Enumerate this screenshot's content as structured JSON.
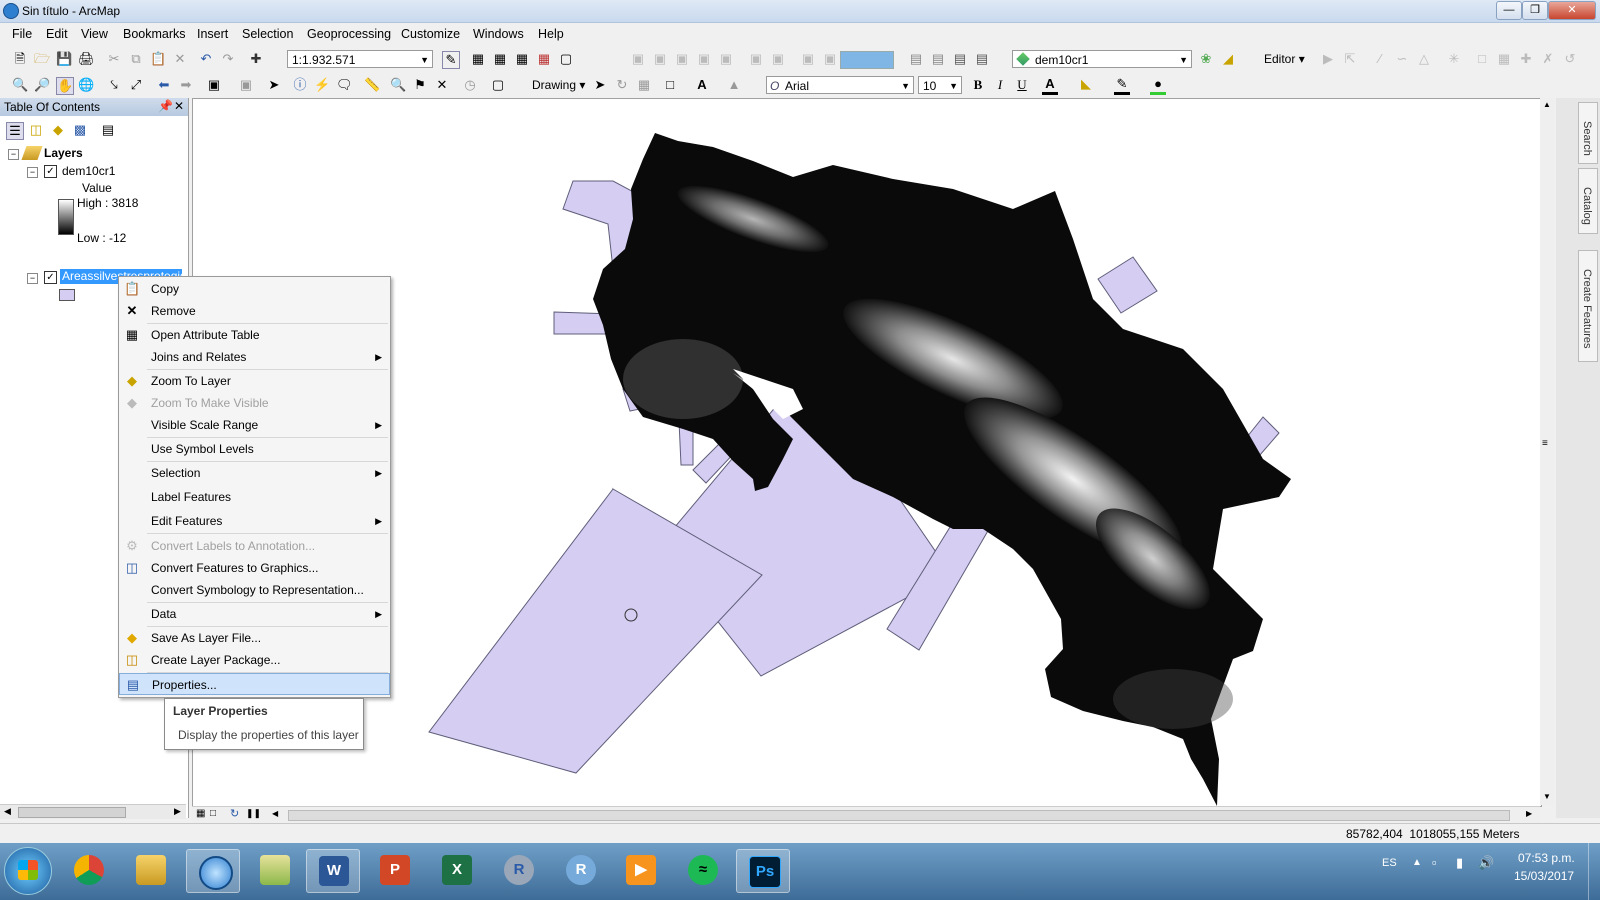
{
  "window": {
    "title": "Sin título - ArcMap",
    "minimize_icon": "minimize-icon",
    "maximize_icon": "maximize-icon",
    "close_icon": "close-icon"
  },
  "menubar": {
    "items": [
      "File",
      "Edit",
      "View",
      "Bookmarks",
      "Insert",
      "Selection",
      "Geoprocessing",
      "Customize",
      "Windows",
      "Help"
    ]
  },
  "toolbar": {
    "scale_value": "1:1.932.571",
    "layer_combo": "dem10cr1",
    "editor_label": "Editor",
    "drawing_label": "Drawing",
    "font_name": "Arial",
    "font_size": "10",
    "bold": "B",
    "italic": "I",
    "underline": "U"
  },
  "toc": {
    "title": "Table Of Contents",
    "root": "Layers",
    "layer1": {
      "name": "dem10cr1",
      "checked": true,
      "legend_title": "Value",
      "high": "High : 3818",
      "low": "Low : -12"
    },
    "layer2": {
      "name": "Areassilvestresprotegid",
      "checked": true,
      "fill_color": "#d6cdf2"
    }
  },
  "context_menu": {
    "copy": "Copy",
    "remove": "Remove",
    "open_attribute_table": "Open Attribute Table",
    "joins_relates": "Joins and Relates",
    "zoom_to_layer": "Zoom To Layer",
    "zoom_to_make_visible": "Zoom To Make Visible",
    "visible_scale_range": "Visible Scale Range",
    "use_symbol_levels": "Use Symbol Levels",
    "selection": "Selection",
    "label_features": "Label Features",
    "edit_features": "Edit Features",
    "convert_labels": "Convert Labels to Annotation...",
    "convert_features": "Convert Features to Graphics...",
    "convert_symbology": "Convert Symbology to Representation...",
    "data": "Data",
    "save_as_layer_file": "Save As Layer File...",
    "create_layer_package": "Create Layer Package...",
    "properties": "Properties..."
  },
  "tooltip": {
    "title": "Layer Properties",
    "text": "Display the properties of this layer"
  },
  "side_tabs": [
    "Search",
    "Catalog",
    "Create Features"
  ],
  "status": {
    "coords": "85782,404  1018055,155 Meters"
  },
  "taskbar": {
    "lang": "ES",
    "time": "07:53 p.m.",
    "date": "15/03/2017"
  },
  "colors": {
    "accent": "#3399ff",
    "polygon_fill": "#d6cdf2",
    "polygon_stroke": "#6b6b8a"
  }
}
